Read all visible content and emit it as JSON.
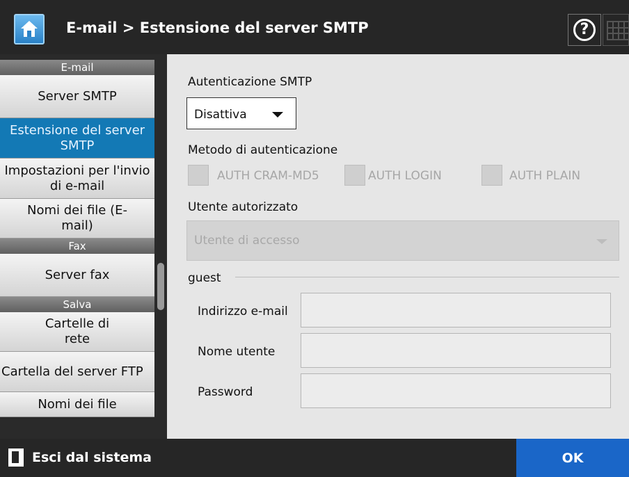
{
  "header": {
    "title": "E-mail > Estensione del server SMTP",
    "home_icon": "home-icon",
    "help_glyph": "?"
  },
  "sidebar": {
    "sections": [
      {
        "category": "E-mail",
        "items": [
          "Server SMTP",
          "Estensione del server SMTP",
          "Impostazioni per l'invio di e-mail",
          "Nomi dei file (E-mail)"
        ]
      },
      {
        "category": "Fax",
        "items": [
          "Server fax"
        ]
      },
      {
        "category": "Salva",
        "items": [
          "Cartelle di rete",
          "Cartella del server FTP",
          "Nomi dei file"
        ]
      }
    ],
    "active_item": "Estensione del server SMTP"
  },
  "main": {
    "smtp_auth_label": "Autenticazione SMTP",
    "smtp_auth_value": "Disattiva",
    "auth_method_label": "Metodo di autenticazione",
    "auth_methods": [
      "AUTH CRAM-MD5",
      "AUTH LOGIN",
      "AUTH PLAIN"
    ],
    "auth_user_label": "Utente autorizzato",
    "auth_user_value": "Utente di accesso",
    "guest_label": "guest",
    "email_label": "Indirizzo e-mail",
    "email_value": "",
    "username_label": "Nome utente",
    "username_value": "",
    "password_label": "Password",
    "password_value": ""
  },
  "footer": {
    "logout_label": "Esci dal sistema",
    "ok_label": "OK"
  },
  "colors": {
    "header_bg": "#262626",
    "active_item": "#1379b5",
    "ok_button": "#1a66c8",
    "main_bg": "#e6e6e6"
  }
}
